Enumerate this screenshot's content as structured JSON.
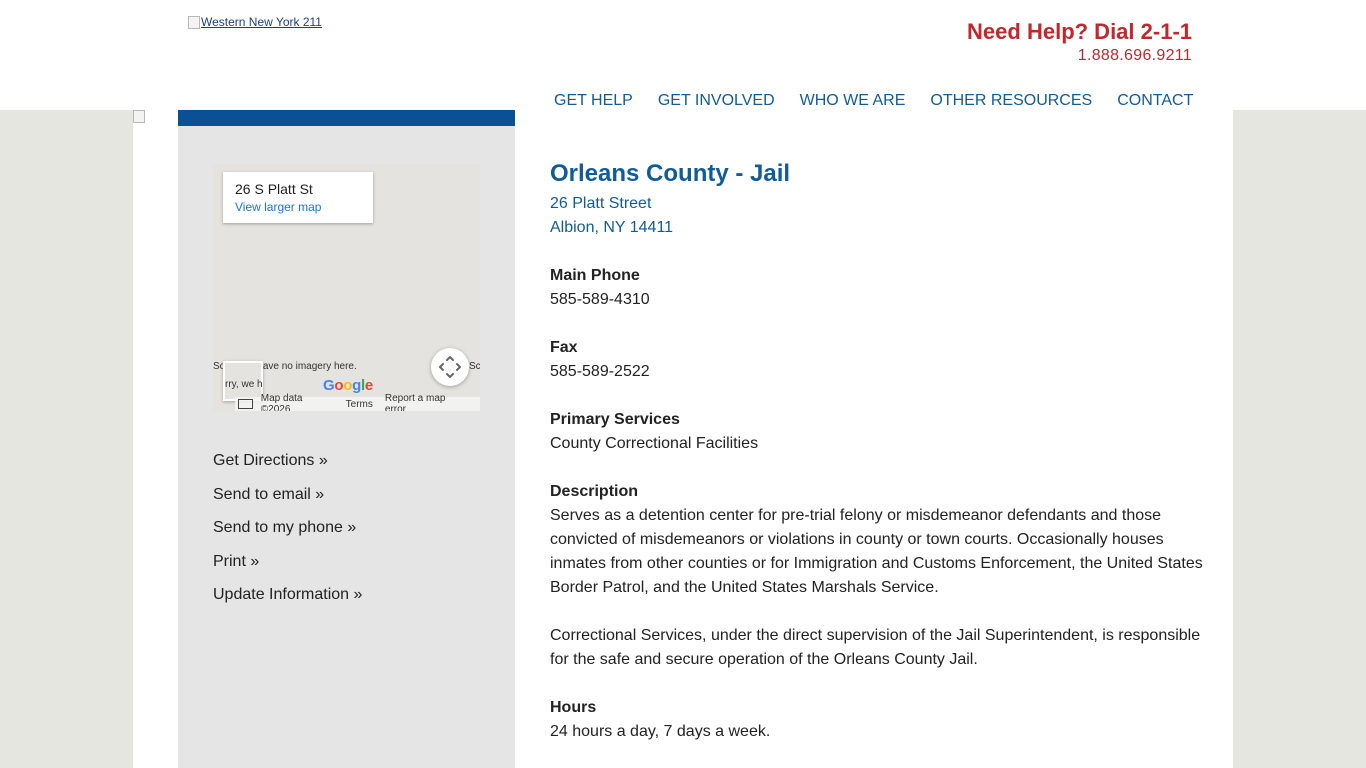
{
  "header": {
    "logo_alt": "Western New York 211",
    "help_title": "Need Help? Dial 2-1-1",
    "help_phone": "1.888.696.9211"
  },
  "nav": {
    "items": [
      "GET HELP",
      "GET INVOLVED",
      "WHO WE ARE",
      "OTHER RESOURCES",
      "CONTACT"
    ]
  },
  "map": {
    "address": "26 S Platt St",
    "view_larger": "View larger map",
    "no_imagery_left": "Sorry, we have no imagery here.",
    "no_imagery_right": "Sc",
    "thumb_text": "rry, we h",
    "google": "Google",
    "footer": [
      "Map data ©2026",
      "Terms",
      "Report a map error"
    ]
  },
  "actions": [
    "Get Directions »",
    "Send to email »",
    "Send to my phone »",
    "Print »",
    "Update Information »"
  ],
  "listing": {
    "title": "Orleans County - Jail",
    "address_line1": "26 Platt Street",
    "address_line2": "Albion, NY 14411",
    "main_phone_label": "Main Phone",
    "main_phone": "585-589-4310",
    "fax_label": "Fax",
    "fax": "585-589-2522",
    "primary_services_label": "Primary Services",
    "primary_services": "County Correctional Facilities",
    "description_label": "Description",
    "description_p1": "Serves as a detention center for pre-trial felony or misdemeanor defendants and those convicted of misdemeanors or violations in county or town courts. Occasionally houses inmates from other counties or for Immigration and Customs Enforcement, the United States Border Patrol, and the United States Marshals Service.",
    "description_p2": "Correctional Services, under the direct supervision of the Jail Superintendent, is responsible for the safe and secure operation of the Orleans County Jail.",
    "hours_label": "Hours",
    "hours": "24 hours a day, 7 days a week."
  },
  "colors": {
    "brand_blue": "#0f5c99",
    "help_red": "#c0282d",
    "sidebar_bar": "#0b4f95",
    "sidebar_bg": "#e5e5e5",
    "page_bg": "#e6e6e1"
  }
}
